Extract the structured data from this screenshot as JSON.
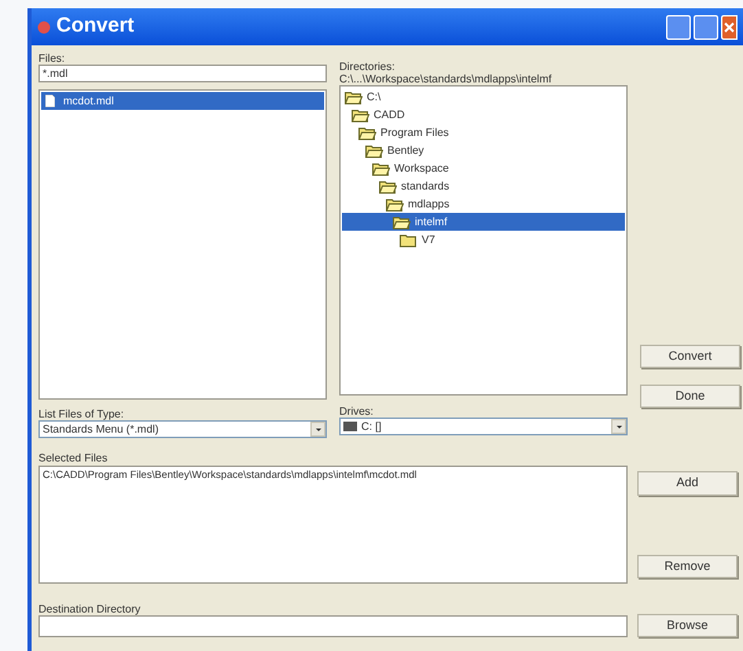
{
  "window": {
    "title": "Convert"
  },
  "files": {
    "label": "Files:",
    "value": "*.mdl",
    "items": [
      {
        "name": "mcdot.mdl",
        "selected": true
      }
    ]
  },
  "directories": {
    "label": "Directories:",
    "path": "C:\\...\\Workspace\\standards\\mdlapps\\intelmf",
    "tree": [
      {
        "name": "C:\\",
        "selected": false,
        "children": [
          {
            "name": "CADD",
            "selected": false,
            "children": [
              {
                "name": "Program Files",
                "selected": false,
                "children": [
                  {
                    "name": "Bentley",
                    "selected": false,
                    "children": [
                      {
                        "name": "Workspace",
                        "selected": false,
                        "children": [
                          {
                            "name": "standards",
                            "selected": false,
                            "children": [
                              {
                                "name": "mdlapps",
                                "selected": false,
                                "children": [
                                  {
                                    "name": "intelmf",
                                    "selected": true,
                                    "children": [
                                      {
                                        "name": "V7",
                                        "selected": false
                                      }
                                    ]
                                  }
                                ]
                              }
                            ]
                          }
                        ]
                      }
                    ]
                  }
                ]
              }
            ]
          }
        ]
      }
    ]
  },
  "file_type": {
    "label": "List Files of Type:",
    "value": "Standards Menu (*.mdl)"
  },
  "drives": {
    "label": "Drives:",
    "value": "C: []"
  },
  "selected_files": {
    "label": "Selected Files",
    "items": [
      "C:\\CADD\\Program Files\\Bentley\\Workspace\\standards\\mdlapps\\intelmf\\mcdot.mdl"
    ]
  },
  "destination": {
    "label": "Destination Directory"
  },
  "buttons": {
    "convert": "Convert",
    "done": "Done",
    "add": "Add",
    "remove": "Remove",
    "browse": "Browse"
  }
}
